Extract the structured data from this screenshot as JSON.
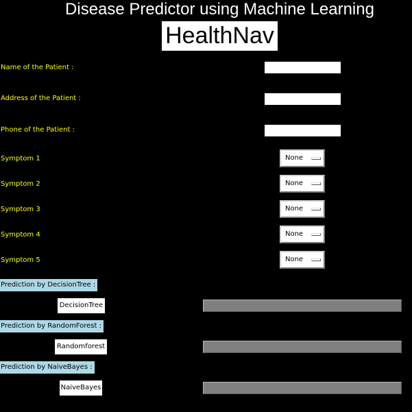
{
  "header": {
    "title": "Disease Predictor using Machine Learning",
    "brand": "HealthNav"
  },
  "patient": {
    "name_label": "Name of the Patient :",
    "name_value": "",
    "address_label": "Address of the Patient :",
    "address_value": "",
    "phone_label": "Phone of the Patient :",
    "phone_value": ""
  },
  "symptoms": [
    {
      "label": "Symptom 1",
      "value": "None"
    },
    {
      "label": "Symptom 2",
      "value": "None"
    },
    {
      "label": "Symptom 3",
      "value": "None"
    },
    {
      "label": "Symptom 4",
      "value": "None"
    },
    {
      "label": "Symptom 5",
      "value": "None"
    }
  ],
  "predictions": [
    {
      "label": "Prediction by DecisionTree :",
      "button": "DecisionTree",
      "result": ""
    },
    {
      "label": "Prediction by RandomForest :",
      "button": "Randomforest",
      "result": ""
    },
    {
      "label": "Prediction by NaiveBayes :",
      "button": "NaiveBayes",
      "result": ""
    }
  ],
  "colors": {
    "background": "#000000",
    "label_text": "#ffff00",
    "prediction_label_bg": "#add8e6",
    "result_field_bg": "#808080"
  }
}
